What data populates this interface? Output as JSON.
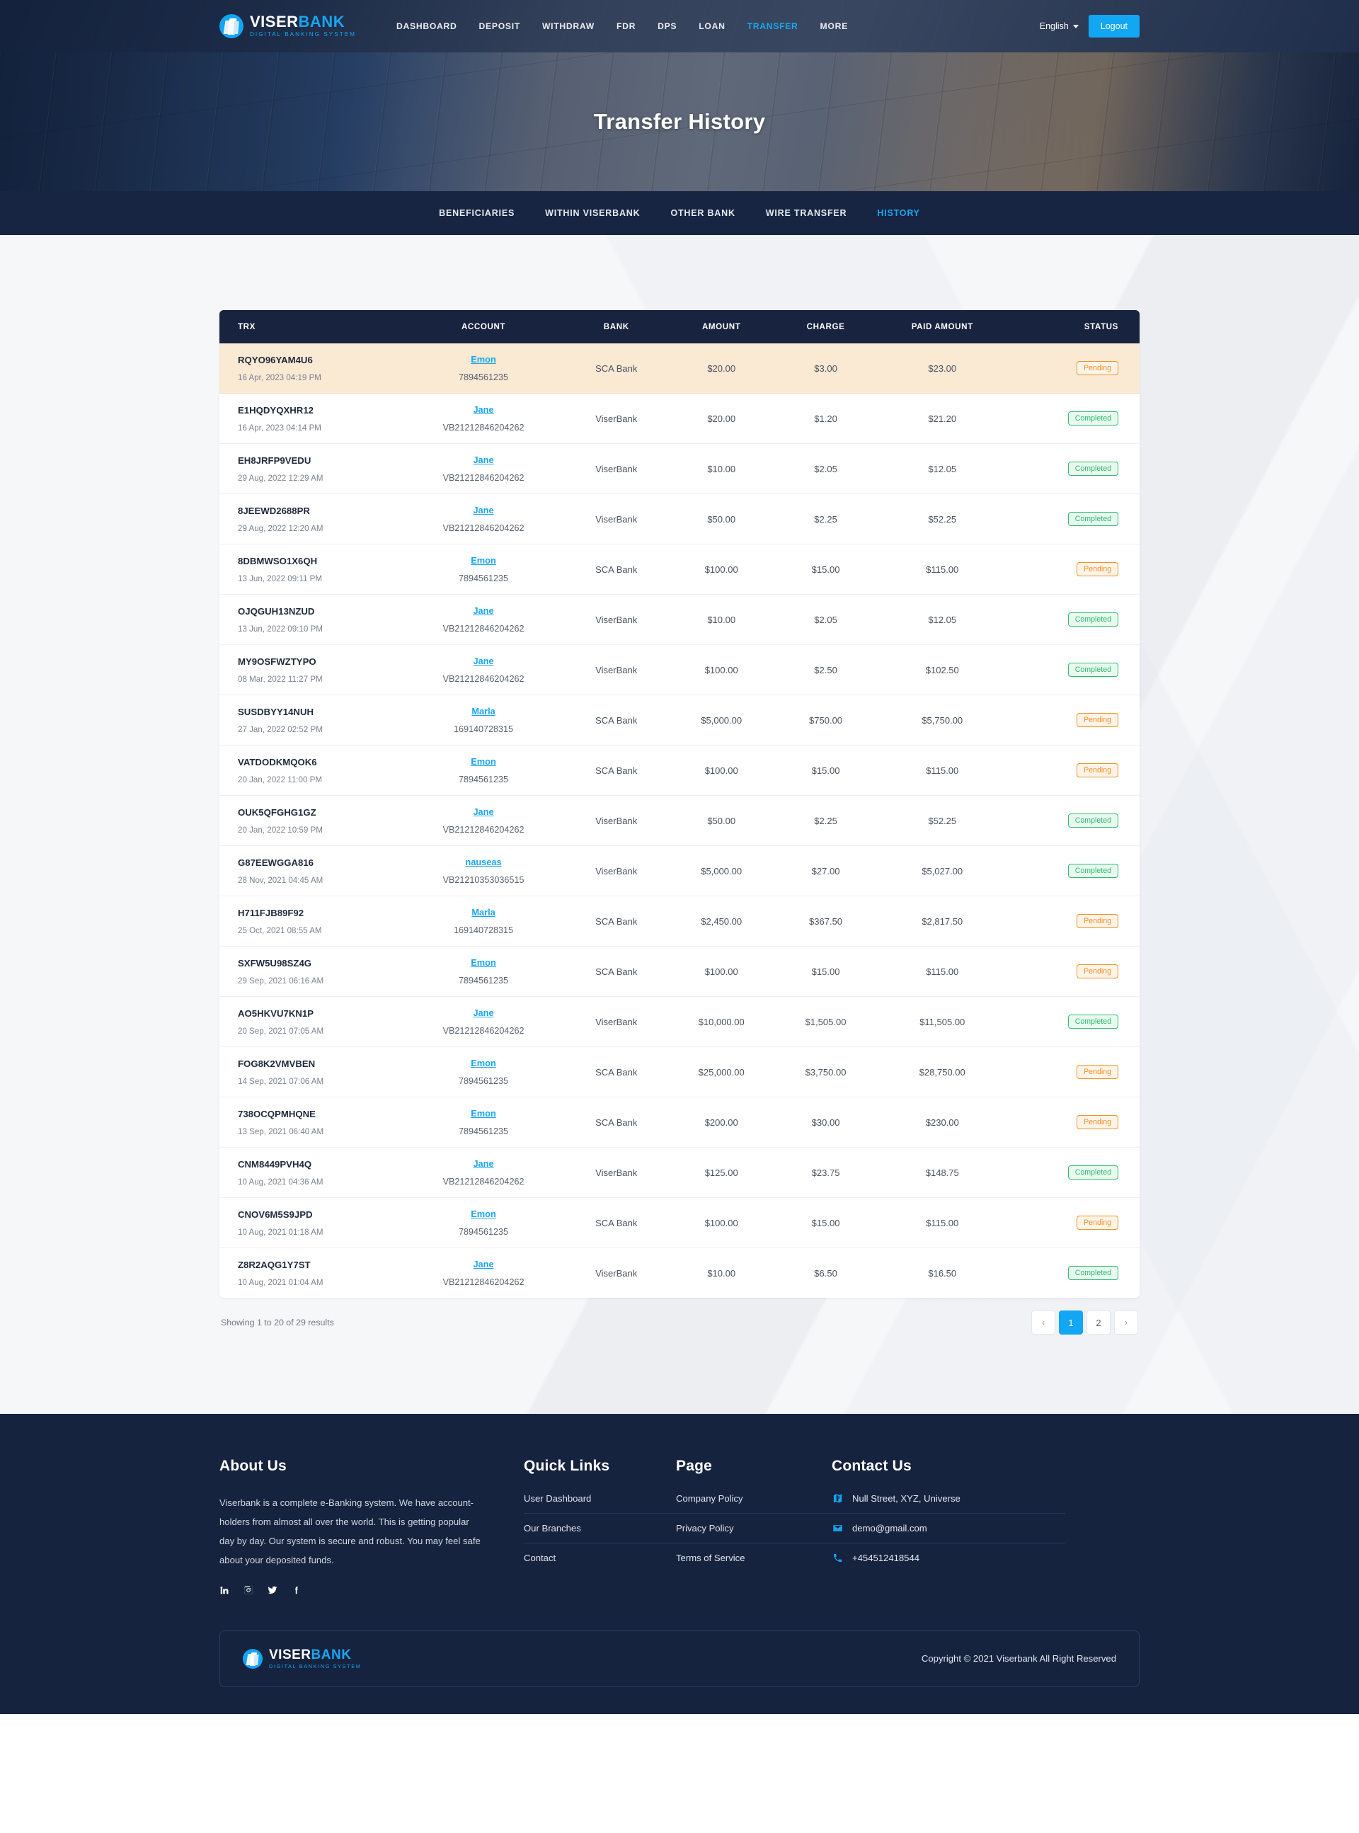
{
  "brand": {
    "name_part1": "VISER",
    "name_part2": "BANK",
    "tagline": "DIGITAL BANKING SYSTEM",
    "accent": "#19a6f0"
  },
  "header": {
    "nav": [
      {
        "label": "DASHBOARD",
        "active": false
      },
      {
        "label": "DEPOSIT",
        "active": false
      },
      {
        "label": "WITHDRAW",
        "active": false
      },
      {
        "label": "FDR",
        "active": false
      },
      {
        "label": "DPS",
        "active": false
      },
      {
        "label": "LOAN",
        "active": false
      },
      {
        "label": "TRANSFER",
        "active": true
      },
      {
        "label": "MORE",
        "active": false
      }
    ],
    "language": "English",
    "logout_label": "Logout"
  },
  "hero": {
    "title": "Transfer History"
  },
  "sub_nav": [
    {
      "label": "BENEFICIARIES",
      "active": false
    },
    {
      "label": "WITHIN VISERBANK",
      "active": false
    },
    {
      "label": "OTHER BANK",
      "active": false
    },
    {
      "label": "WIRE TRANSFER",
      "active": false
    },
    {
      "label": "HISTORY",
      "active": true
    }
  ],
  "table": {
    "columns": [
      "TRX",
      "ACCOUNT",
      "BANK",
      "AMOUNT",
      "CHARGE",
      "PAID AMOUNT",
      "STATUS"
    ],
    "rows": [
      {
        "trx": "RQYO96YAM4U6",
        "date": "16 Apr, 2023 04:19 PM",
        "name": "Emon",
        "account": "7894561235",
        "bank": "SCA Bank",
        "amount": "$20.00",
        "charge": "$3.00",
        "paid": "$23.00",
        "status": "Pending",
        "highlight": true
      },
      {
        "trx": "E1HQDYQXHR12",
        "date": "16 Apr, 2023 04:14 PM",
        "name": "Jane",
        "account": "VB21212846204262",
        "bank": "ViserBank",
        "amount": "$20.00",
        "charge": "$1.20",
        "paid": "$21.20",
        "status": "Completed",
        "highlight": false
      },
      {
        "trx": "EH8JRFP9VEDU",
        "date": "29 Aug, 2022 12:29 AM",
        "name": "Jane",
        "account": "VB21212846204262",
        "bank": "ViserBank",
        "amount": "$10.00",
        "charge": "$2.05",
        "paid": "$12.05",
        "status": "Completed",
        "highlight": false
      },
      {
        "trx": "8JEEWD2688PR",
        "date": "29 Aug, 2022 12:20 AM",
        "name": "Jane",
        "account": "VB21212846204262",
        "bank": "ViserBank",
        "amount": "$50.00",
        "charge": "$2.25",
        "paid": "$52.25",
        "status": "Completed",
        "highlight": false
      },
      {
        "trx": "8DBMWSO1X6QH",
        "date": "13 Jun, 2022 09:11 PM",
        "name": "Emon",
        "account": "7894561235",
        "bank": "SCA Bank",
        "amount": "$100.00",
        "charge": "$15.00",
        "paid": "$115.00",
        "status": "Pending",
        "highlight": false
      },
      {
        "trx": "OJQGUH13NZUD",
        "date": "13 Jun, 2022 09:10 PM",
        "name": "Jane",
        "account": "VB21212846204262",
        "bank": "ViserBank",
        "amount": "$10.00",
        "charge": "$2.05",
        "paid": "$12.05",
        "status": "Completed",
        "highlight": false
      },
      {
        "trx": "MY9OSFWZTYPO",
        "date": "08 Mar, 2022 11:27 PM",
        "name": "Jane",
        "account": "VB21212846204262",
        "bank": "ViserBank",
        "amount": "$100.00",
        "charge": "$2.50",
        "paid": "$102.50",
        "status": "Completed",
        "highlight": false
      },
      {
        "trx": "SUSDBYY14NUH",
        "date": "27 Jan, 2022 02:52 PM",
        "name": "Marla",
        "account": "169140728315",
        "bank": "SCA Bank",
        "amount": "$5,000.00",
        "charge": "$750.00",
        "paid": "$5,750.00",
        "status": "Pending",
        "highlight": false
      },
      {
        "trx": "VATDODKMQOK6",
        "date": "20 Jan, 2022 11:00 PM",
        "name": "Emon",
        "account": "7894561235",
        "bank": "SCA Bank",
        "amount": "$100.00",
        "charge": "$15.00",
        "paid": "$115.00",
        "status": "Pending",
        "highlight": false
      },
      {
        "trx": "OUK5QFGHG1GZ",
        "date": "20 Jan, 2022 10:59 PM",
        "name": "Jane",
        "account": "VB21212846204262",
        "bank": "ViserBank",
        "amount": "$50.00",
        "charge": "$2.25",
        "paid": "$52.25",
        "status": "Completed",
        "highlight": false
      },
      {
        "trx": "G87EEWGGA816",
        "date": "28 Nov, 2021 04:45 AM",
        "name": "nauseas",
        "account": "VB21210353036515",
        "bank": "ViserBank",
        "amount": "$5,000.00",
        "charge": "$27.00",
        "paid": "$5,027.00",
        "status": "Completed",
        "highlight": false
      },
      {
        "trx": "H711FJB89F92",
        "date": "25 Oct, 2021 08:55 AM",
        "name": "Marla",
        "account": "169140728315",
        "bank": "SCA Bank",
        "amount": "$2,450.00",
        "charge": "$367.50",
        "paid": "$2,817.50",
        "status": "Pending",
        "highlight": false
      },
      {
        "trx": "SXFW5U98SZ4G",
        "date": "29 Sep, 2021 06:16 AM",
        "name": "Emon",
        "account": "7894561235",
        "bank": "SCA Bank",
        "amount": "$100.00",
        "charge": "$15.00",
        "paid": "$115.00",
        "status": "Pending",
        "highlight": false
      },
      {
        "trx": "AO5HKVU7KN1P",
        "date": "20 Sep, 2021 07:05 AM",
        "name": "Jane",
        "account": "VB21212846204262",
        "bank": "ViserBank",
        "amount": "$10,000.00",
        "charge": "$1,505.00",
        "paid": "$11,505.00",
        "status": "Completed",
        "highlight": false
      },
      {
        "trx": "FOG8K2VMVBEN",
        "date": "14 Sep, 2021 07:06 AM",
        "name": "Emon",
        "account": "7894561235",
        "bank": "SCA Bank",
        "amount": "$25,000.00",
        "charge": "$3,750.00",
        "paid": "$28,750.00",
        "status": "Pending",
        "highlight": false
      },
      {
        "trx": "738OCQPMHQNE",
        "date": "13 Sep, 2021 06:40 AM",
        "name": "Emon",
        "account": "7894561235",
        "bank": "SCA Bank",
        "amount": "$200.00",
        "charge": "$30.00",
        "paid": "$230.00",
        "status": "Pending",
        "highlight": false
      },
      {
        "trx": "CNM8449PVH4Q",
        "date": "10 Aug, 2021 04:36 AM",
        "name": "Jane",
        "account": "VB21212846204262",
        "bank": "ViserBank",
        "amount": "$125.00",
        "charge": "$23.75",
        "paid": "$148.75",
        "status": "Completed",
        "highlight": false
      },
      {
        "trx": "CNOV6M5S9JPD",
        "date": "10 Aug, 2021 01:18 AM",
        "name": "Emon",
        "account": "7894561235",
        "bank": "SCA Bank",
        "amount": "$100.00",
        "charge": "$15.00",
        "paid": "$115.00",
        "status": "Pending",
        "highlight": false
      },
      {
        "trx": "Z8R2AQG1Y7ST",
        "date": "10 Aug, 2021 01:04 AM",
        "name": "Jane",
        "account": "VB21212846204262",
        "bank": "ViserBank",
        "amount": "$10.00",
        "charge": "$6.50",
        "paid": "$16.50",
        "status": "Completed",
        "highlight": false
      }
    ],
    "showing_text": "Showing 1 to 20 of 29 results",
    "pagination": [
      {
        "label": "‹",
        "active": false,
        "arrow": true
      },
      {
        "label": "1",
        "active": true,
        "arrow": false
      },
      {
        "label": "2",
        "active": false,
        "arrow": false
      },
      {
        "label": "›",
        "active": false,
        "arrow": true
      }
    ]
  },
  "footer": {
    "about": {
      "title": "About Us",
      "text": "Viserbank is a complete e-Banking system. We have account-holders from almost all over the world. This is getting popular day by day. Our system is secure and robust. You may feel safe about your deposited funds."
    },
    "socials": [
      {
        "name": "linkedin-icon"
      },
      {
        "name": "instagram-icon"
      },
      {
        "name": "twitter-icon"
      },
      {
        "name": "facebook-icon"
      }
    ],
    "quick_links": {
      "title": "Quick Links",
      "items": [
        "User Dashboard",
        "Our Branches",
        "Contact"
      ]
    },
    "page_links": {
      "title": "Page",
      "items": [
        "Company Policy",
        "Privacy Policy",
        "Terms of Service"
      ]
    },
    "contact": {
      "title": "Contact Us",
      "items": [
        {
          "icon": "map-icon",
          "text": "Null Street, XYZ, Universe"
        },
        {
          "icon": "email-icon",
          "text": "demo@gmail.com"
        },
        {
          "icon": "phone-icon",
          "text": "+454512418544"
        }
      ]
    },
    "copyright": "Copyright © 2021 Viserbank All Right Reserved"
  }
}
